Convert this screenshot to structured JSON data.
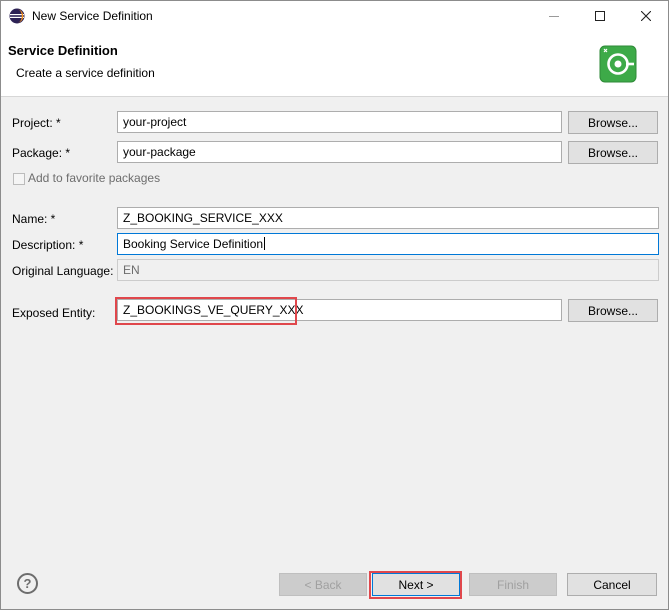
{
  "window": {
    "title": "New Service Definition"
  },
  "banner": {
    "title": "Service Definition",
    "description": "Create a service definition"
  },
  "form": {
    "project_label": "Project: *",
    "project_value": "your-project",
    "package_label": "Package: *",
    "package_value": "your-package",
    "favorite_label": "Add to favorite packages",
    "name_label": "Name: *",
    "name_value": "Z_BOOKING_SERVICE_XXX",
    "description_label": "Description: *",
    "description_value": "Booking Service Definition",
    "language_label": "Original Language:",
    "language_value": "EN",
    "entity_label": "Exposed Entity:",
    "entity_value": "Z_BOOKINGS_VE_QUERY_XXX",
    "browse_label": "Browse..."
  },
  "footer": {
    "help": "?",
    "back": "< Back",
    "next": "Next >",
    "finish": "Finish",
    "cancel": "Cancel"
  },
  "colors": {
    "highlight": "#e0474c",
    "focus": "#0078d7",
    "brand_icon": "#39a845"
  }
}
